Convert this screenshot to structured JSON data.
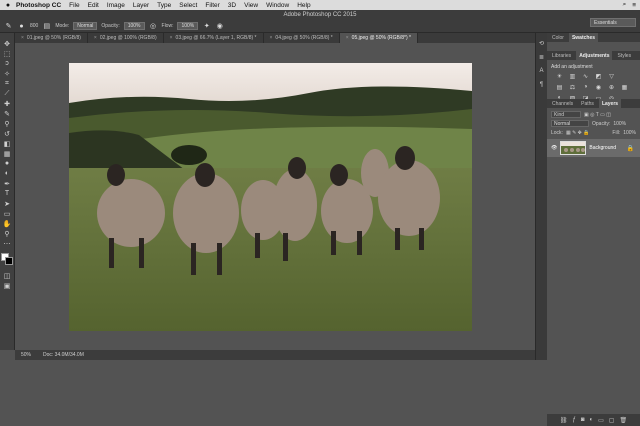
{
  "menubar": {
    "apple": "",
    "app_name": "Photoshop CC",
    "items": [
      "File",
      "Edit",
      "Image",
      "Layer",
      "Type",
      "Select",
      "Filter",
      "3D",
      "View",
      "Window",
      "Help"
    ],
    "right": [
      "⌕",
      "≡"
    ]
  },
  "window_title": "Adobe Photoshop CC 2015",
  "options": {
    "brush_size": "800",
    "mode_label": "Mode:",
    "mode_value": "Normal",
    "opacity_label": "Opacity:",
    "opacity_value": "100%",
    "flow_label": "Flow:",
    "flow_value": "100%",
    "workspace": "Essentials"
  },
  "tabs": [
    "01.jpeg @ 50% (RGB/8)",
    "02.jpeg @ 100% (RGB/8)",
    "03.jpeg @ 66.7% (Layer 1, RGB/8) *",
    "04.jpeg @ 50% (RGB/8) *",
    "05.jpeg @ 50% (RGB/8*) *"
  ],
  "status": {
    "zoom": "50%",
    "doc": "Doc: 34.0M/34.0M"
  },
  "panels": {
    "top_tabs": [
      "Color",
      "Swatches"
    ],
    "mid_tabs": [
      "Libraries",
      "Adjustments",
      "Styles"
    ],
    "adjust_header": "Add an adjustment",
    "layer_tabs": [
      "Channels",
      "Paths",
      "Layers"
    ],
    "kind_label": "Kind",
    "blend_mode": "Normal",
    "opacity_label": "Opacity:",
    "opacity_value": "100%",
    "lock_label": "Lock:",
    "fill_label": "Fill:",
    "fill_value": "100%",
    "layer_name": "Background"
  },
  "colors": {
    "accent": "#2d8ceb",
    "panel": "#535353",
    "chrome": "#3c3c3c"
  }
}
